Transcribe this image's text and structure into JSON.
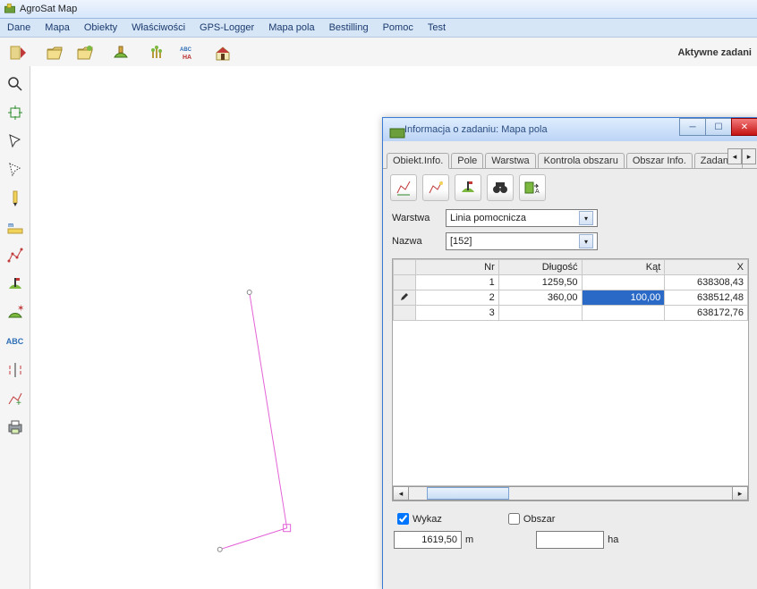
{
  "window": {
    "title": "AgroSat Map"
  },
  "menu": [
    "Dane",
    "Mapa",
    "Obiekty",
    "Właściwości",
    "GPS-Logger",
    "Mapa pola",
    "Bestilling",
    "Pomoc",
    "Test"
  ],
  "status_text": "Aktywne zadani",
  "dialog": {
    "title": "Informacja o zadaniu: Mapa pola",
    "tabs": [
      "Obiekt.Info.",
      "Pole",
      "Warstwa",
      "Kontrola obszaru",
      "Obszar Info.",
      "Zadanie"
    ],
    "active_tab_index": 0,
    "fields": {
      "warstwa": {
        "label": "Warstwa",
        "value": "Linia pomocnicza"
      },
      "nazwa": {
        "label": "Nazwa",
        "value": "[152]"
      }
    },
    "columns": [
      "Nr",
      "Długość",
      "Kąt",
      "X"
    ],
    "rows": [
      {
        "nr": "1",
        "len": "1259,50",
        "ang": "",
        "x": "638308,43",
        "edit": false,
        "sel": false
      },
      {
        "nr": "2",
        "len": "360,00",
        "ang": "100,00",
        "x": "638512,48",
        "edit": true,
        "sel": true
      },
      {
        "nr": "3",
        "len": "",
        "ang": "",
        "x": "638172,76",
        "edit": false,
        "sel": false
      }
    ],
    "wykaz": {
      "label": "Wykaz",
      "checked": true,
      "value": "1619,50",
      "unit": "m"
    },
    "obszar": {
      "label": "Obszar",
      "checked": false,
      "value": "",
      "unit": "ha"
    }
  }
}
